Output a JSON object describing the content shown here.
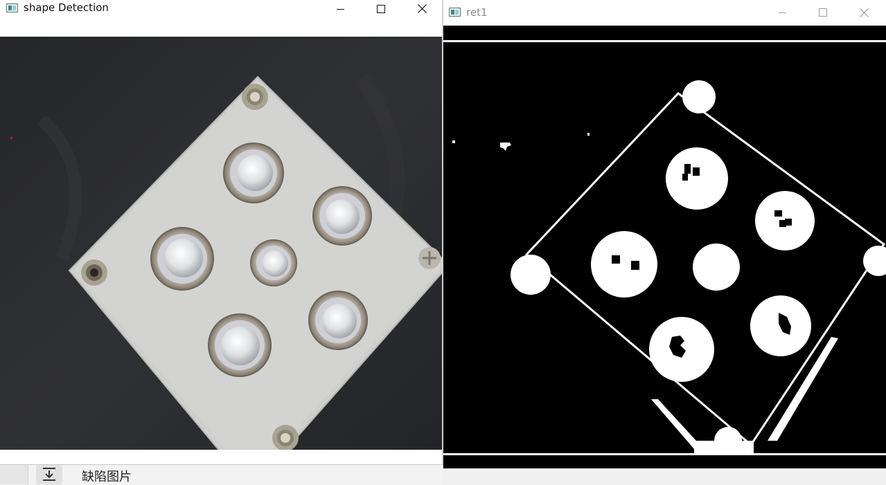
{
  "windows": {
    "shape": {
      "title": "shape Detection",
      "app_icon": "opencv-window-icon",
      "controls": [
        "minimize-icon",
        "maximize-icon",
        "close-icon"
      ]
    },
    "ret1": {
      "title": "ret1",
      "app_icon": "opencv-window-icon",
      "controls": [
        "minimize-icon",
        "maximize-icon",
        "close-icon"
      ]
    }
  },
  "background_app": {
    "label": "缺陷图片",
    "button_icon": "download-icon"
  },
  "colors": {
    "titlebar_bg": "#ffffff",
    "photo_background": "#2a2b2e",
    "enclosure": "#cfd0cd",
    "binary_fg": "#ffffff",
    "binary_bg": "#000000",
    "inactive_title": "#8a8a8a"
  }
}
